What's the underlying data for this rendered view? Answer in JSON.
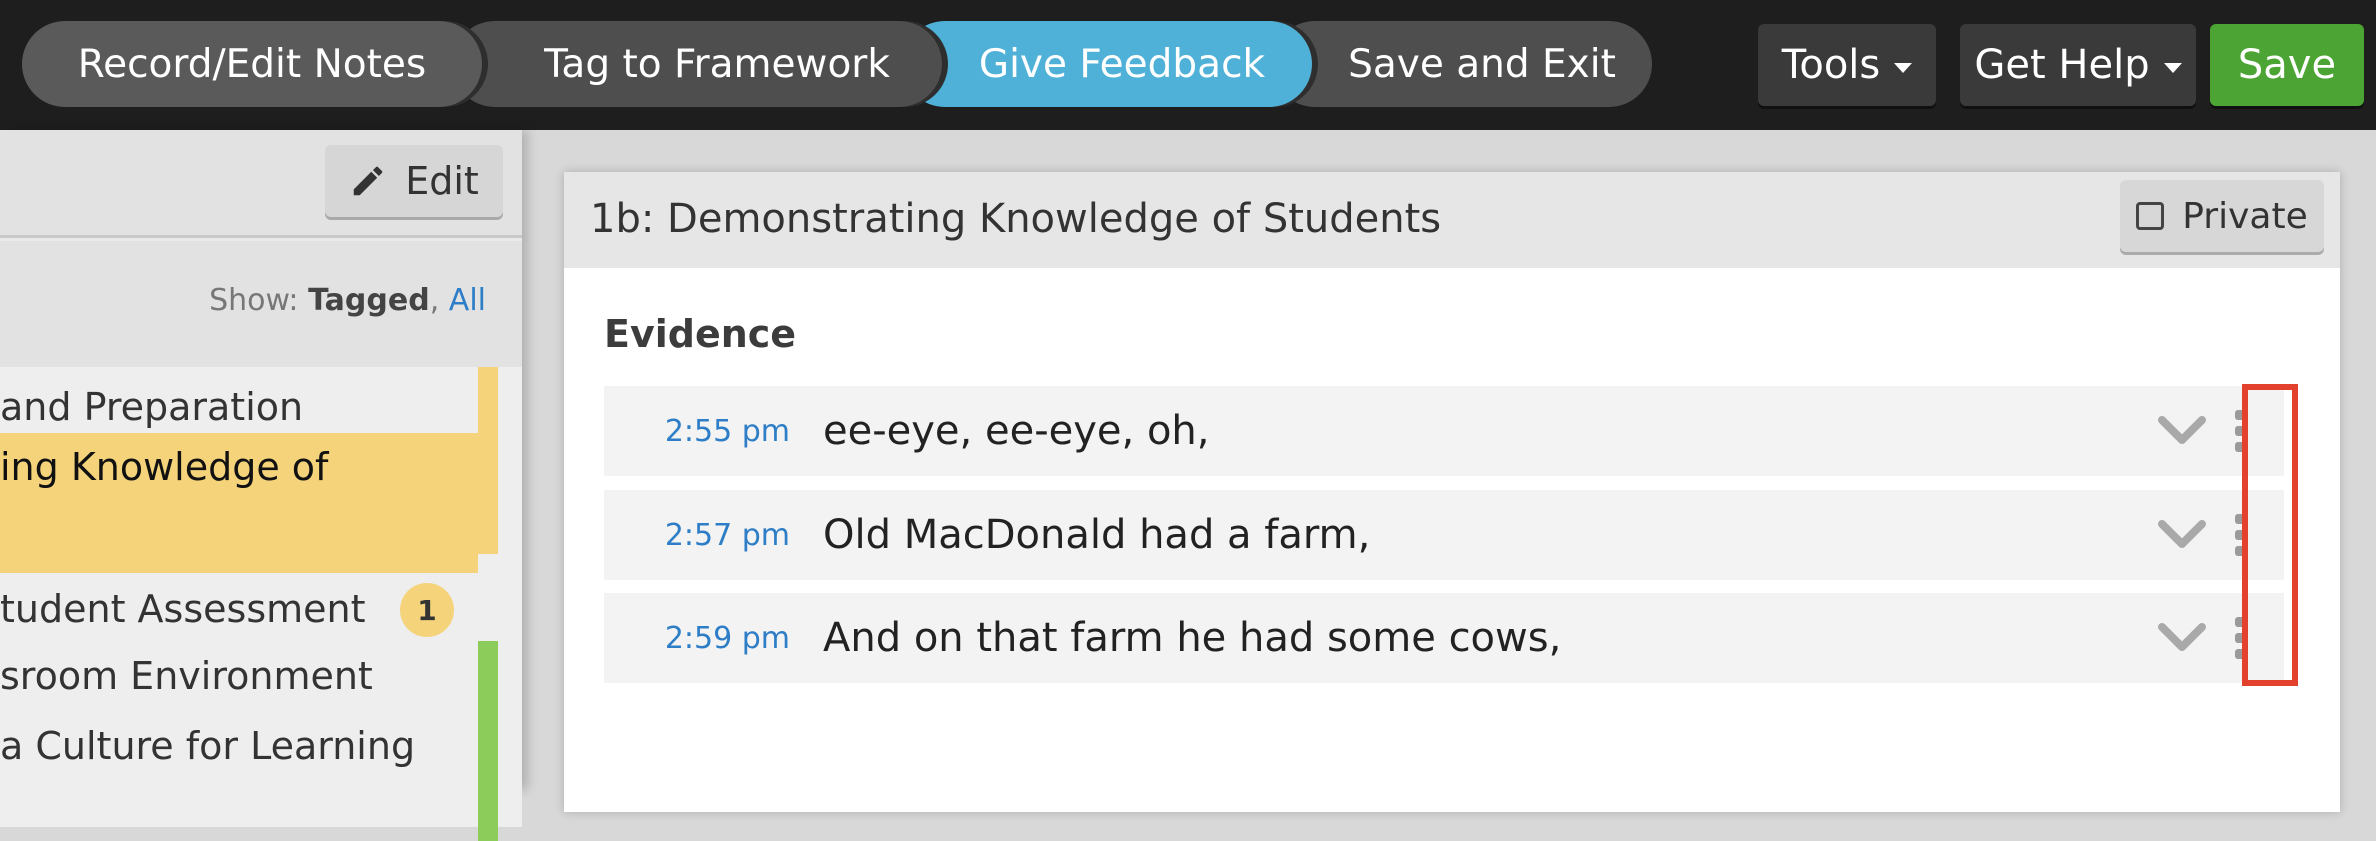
{
  "nav": {
    "steps": [
      "Record/Edit Notes",
      "Tag to Framework",
      "Give Feedback",
      "Save and Exit"
    ],
    "active_step": "Give Feedback",
    "tools_label": "Tools",
    "help_label": "Get Help",
    "save_label": "Save"
  },
  "sidebar": {
    "edit_label": "Edit",
    "show_prefix": "Show:",
    "show_tagged": "Tagged",
    "show_sep": ",",
    "show_all": "All",
    "items": [
      "and Preparation",
      "ing Knowledge of",
      "tudent Assessment",
      "sroom Environment",
      "a Culture for Learning"
    ],
    "badge_count": "1"
  },
  "card": {
    "title": "1b: Demonstrating Knowledge of Students",
    "private_label": "Private",
    "evidence_label": "Evidence",
    "rows": [
      {
        "time": "2:55 pm",
        "text": "ee-eye, ee-eye, oh,"
      },
      {
        "time": "2:57 pm",
        "text": "Old MacDonald had a farm,"
      },
      {
        "time": "2:59 pm",
        "text": "And on that farm he had some cows,"
      }
    ]
  },
  "colors": {
    "active_step": "#4fb1d8",
    "save": "#4ca434",
    "highlight": "#e2422d",
    "selected_item": "#f4d37a",
    "link": "#2e7ec7"
  }
}
